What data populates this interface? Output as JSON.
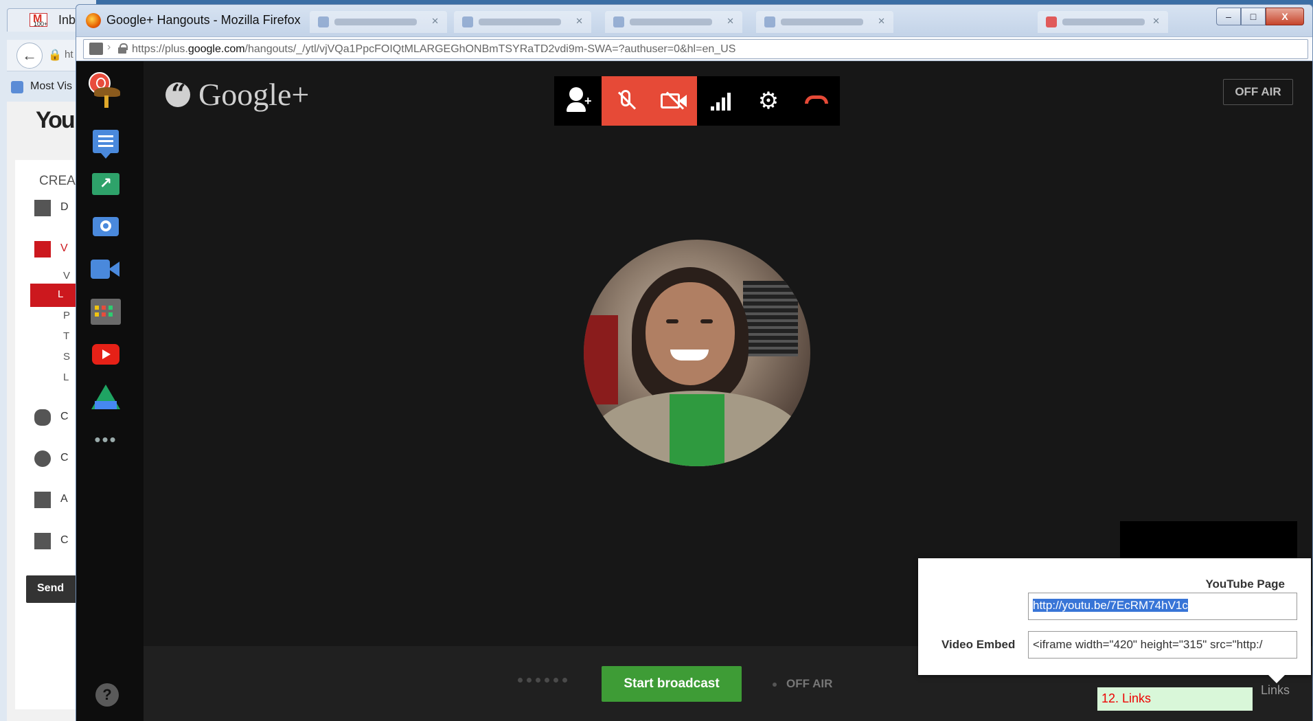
{
  "background_window": {
    "tab_label": "Inbo",
    "gmail_count": "100+",
    "url_fragment": "ht",
    "bookmarks_label": "Most Vis",
    "youtube_logo": "You",
    "create_label": "CREA",
    "menu_rows": [
      {
        "letter": "D"
      },
      {
        "letter": "V"
      }
    ],
    "sub_items": [
      "V",
      "L",
      "P",
      "T",
      "S",
      "L"
    ],
    "lower_rows": [
      {
        "letter": "C"
      },
      {
        "letter": "C"
      },
      {
        "letter": "A"
      },
      {
        "letter": "C"
      }
    ],
    "send_label": "Send"
  },
  "window": {
    "title": "Google+ Hangouts - Mozilla Firefox",
    "url_prefix": "https://plus.",
    "url_domain": "google.com",
    "url_suffix": "/hangouts/_/ytl/vjVQa1PpcFOIQtMLARGEGhONBmTSYRaTD2vdi9m-SWA=?authuser=0&hl=en_US",
    "caption_buttons": {
      "minimize": "–",
      "maximize": "□",
      "close": "X"
    }
  },
  "hangout": {
    "brand": "Google+",
    "off_air_top": "OFF AIR",
    "sidebar_more": "•••",
    "help": "?",
    "toolbar": {
      "invite_plus": "+",
      "settings_glyph": "⚙"
    },
    "bottom": {
      "start_broadcast": "Start broadcast",
      "off_air": "OFF AIR"
    },
    "links_popup": {
      "youtube_page_label": "YouTube Page",
      "youtube_page_value": "http://youtu.be/7EcRM74hV1c",
      "video_embed_label": "Video Embed",
      "video_embed_value": "<iframe width=\"420\" height=\"315\" src=\"http:/"
    },
    "annotation": "12. Links",
    "links_tab": "Links"
  },
  "colors": {
    "accent_red": "#e64a37",
    "broadcast_green": "#3e9c36",
    "selection_blue": "#3875d7"
  }
}
